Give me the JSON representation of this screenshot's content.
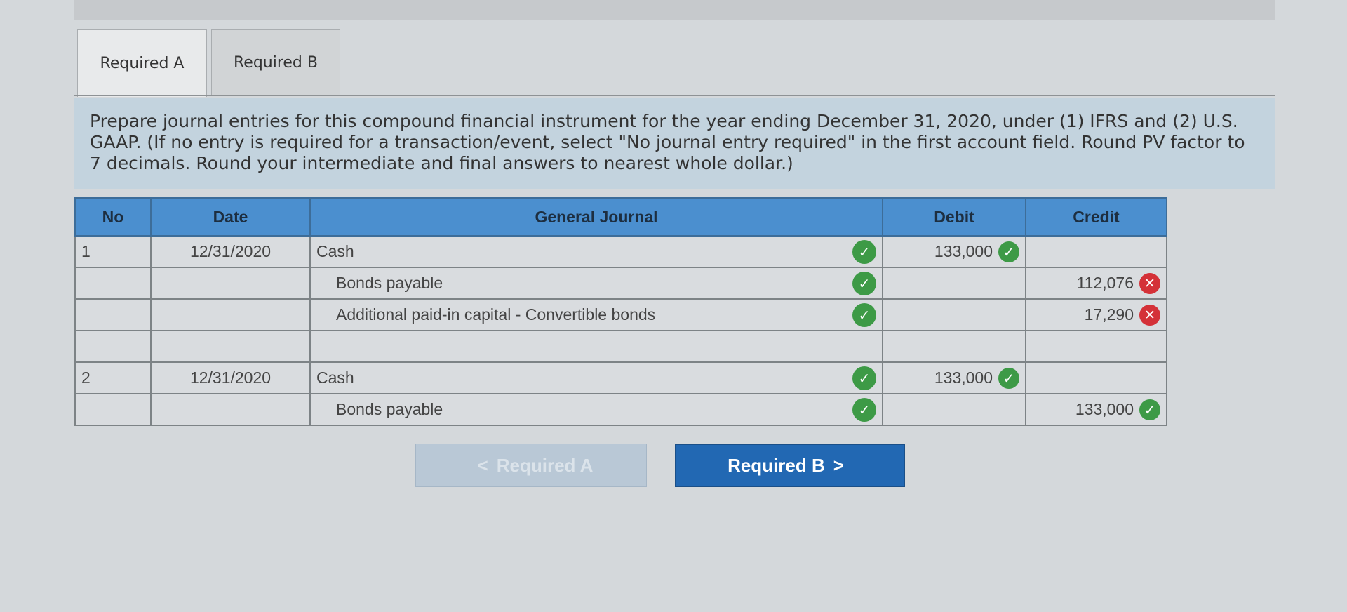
{
  "tabs": [
    {
      "label": "Required A",
      "active": true
    },
    {
      "label": "Required B",
      "active": false
    }
  ],
  "instructions": "Prepare journal entries for this compound financial instrument for the year ending December 31, 2020, under (1) IFRS and (2) U.S. GAAP. (If no entry is required for a transaction/event, select \"No journal entry required\" in the first account field. Round PV factor to 7 decimals. Round your intermediate and final answers to nearest whole dollar.)",
  "table": {
    "headers": {
      "no": "No",
      "date": "Date",
      "general_journal": "General Journal",
      "debit": "Debit",
      "credit": "Credit"
    },
    "rows": [
      {
        "no": "1",
        "date": "12/31/2020",
        "account": "Cash",
        "debit": "133,000",
        "credit": ""
      },
      {
        "no": "",
        "date": "",
        "account": "Bonds payable",
        "debit": "",
        "credit": "112,076"
      },
      {
        "no": "",
        "date": "",
        "account": "Additional paid-in capital - Convertible bonds",
        "debit": "",
        "credit": "17,290"
      },
      {
        "no": "",
        "date": "",
        "account": "",
        "debit": "",
        "credit": ""
      },
      {
        "no": "2",
        "date": "12/31/2020",
        "account": "Cash",
        "debit": "133,000",
        "credit": ""
      },
      {
        "no": "",
        "date": "",
        "account": "Bonds payable",
        "debit": "",
        "credit": "133,000"
      }
    ]
  },
  "buttons": {
    "prev_label": "Required A",
    "next_label": "Required B"
  },
  "icons": {
    "check": "check-circle-icon",
    "error": "x-circle-icon"
  },
  "colors": {
    "header_blue": "#4b8fcf",
    "correct": "#3d9a46",
    "incorrect": "#d43138",
    "button_blue": "#2268b3"
  }
}
